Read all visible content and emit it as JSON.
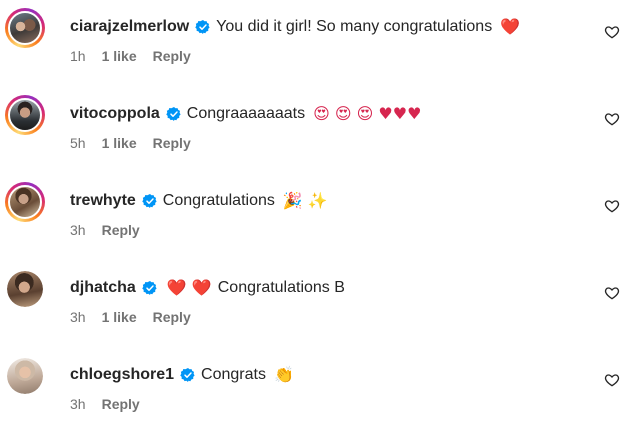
{
  "comments": [
    {
      "username": "ciarajzelmerlow",
      "text": "You did it girl! So many congratulations",
      "emoji": "❤️",
      "time": "1h",
      "likes": "1 like",
      "reply": "Reply",
      "avatar_icon": "story-ring-avatar"
    },
    {
      "username": "vitocoppola",
      "text": "Congraaaaaaats",
      "emoji": "😍 😍 😍 ♥♥♥",
      "time": "5h",
      "likes": "1 like",
      "reply": "Reply",
      "avatar_icon": "story-ring-avatar"
    },
    {
      "username": "trewhyte",
      "text": "Congratulations",
      "emoji": "🎉  ✨",
      "time": "3h",
      "likes": "",
      "reply": "Reply",
      "avatar_icon": "story-ring-avatar"
    },
    {
      "username": "djhatcha",
      "prefix_emoji": "❤️ ❤️",
      "text": "Congratulations B",
      "time": "3h",
      "likes": "1 like",
      "reply": "Reply",
      "avatar_icon": "plain-avatar"
    },
    {
      "username": "chloegshore1",
      "text": "Congrats",
      "emoji": "👏",
      "time": "3h",
      "likes": "",
      "reply": "Reply",
      "avatar_icon": "plain-avatar"
    }
  ],
  "colors": {
    "text": "#262626",
    "meta": "#737373",
    "verified": "#0095f6",
    "heart": "#e4182b"
  },
  "icons": {
    "verified": "verified-badge-icon",
    "like": "heart-outline-icon"
  }
}
